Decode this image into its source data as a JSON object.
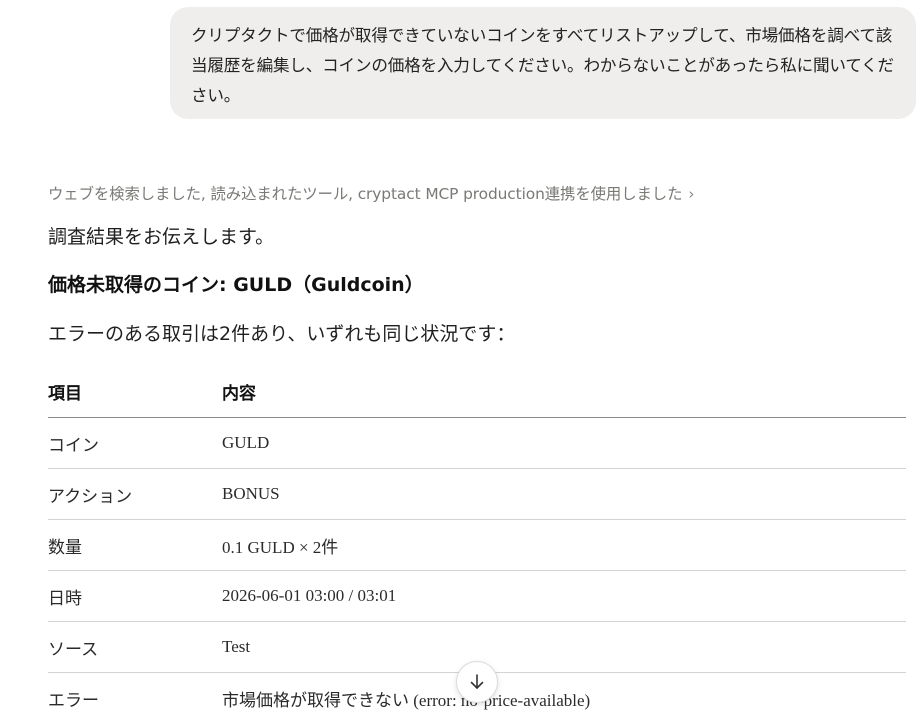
{
  "user_message": {
    "lines": [
      "クリプタクトで価格が取得できていないコインをすべてリストアップして、市場価格を調べて該",
      "当履歴を編集し、コインの価格を入力してください。わからないことがあったら私に聞いてくだ",
      "さい。"
    ]
  },
  "assistant": {
    "tool_summary": "ウェブを検索しました, 読み込まれたツール, cryptact MCP production連携を使用しました",
    "intro": "調査結果をお伝えします。",
    "heading": "価格未取得のコイン: GULD（Guldcoin）",
    "summary": "エラーのある取引は2件あり、いずれも同じ状況です：",
    "table": {
      "headers": [
        "項目",
        "内容"
      ],
      "rows": [
        [
          "コイン",
          "GULD"
        ],
        [
          "アクション",
          "BONUS"
        ],
        [
          "数量",
          "0.1 GULD × 2件"
        ],
        [
          "日時",
          "2026-06-01 03:00 / 03:01"
        ],
        [
          "ソース",
          "Test"
        ],
        [
          "エラー",
          "市場価格が取得できない (error: no-price-available)"
        ]
      ]
    }
  },
  "icons": {
    "tool_chevron": "chevron-right-icon",
    "scroll_button": "arrow-down-icon"
  },
  "colors": {
    "bubble_bg": "#efeeec",
    "muted_text": "#7a7975",
    "body_text": "#1f1f1f"
  }
}
